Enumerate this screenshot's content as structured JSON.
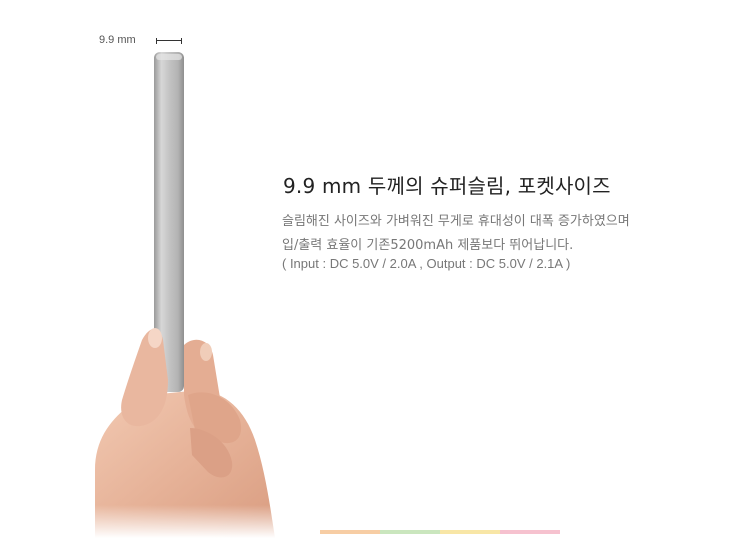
{
  "dimension": {
    "label": "9.9 mm"
  },
  "headline": "9.9 mm 두께의 슈퍼슬림, 포켓사이즈",
  "description": {
    "line1": "슬림해진 사이즈와 가벼워진 무게로 휴대성이 대폭 증가하였으며",
    "line2": "입/출력 효율이 기존5200mAh 제품보다 뛰어납니다.",
    "line3": "( Input : DC 5.0V / 2.0A , Output : DC 5.0V / 2.1A )"
  },
  "colors": {
    "background": "#ffffff",
    "device_silver": "#bdbdbd",
    "skin": "#e8b49c",
    "text_dark": "#222222",
    "text_muted": "#777777"
  }
}
